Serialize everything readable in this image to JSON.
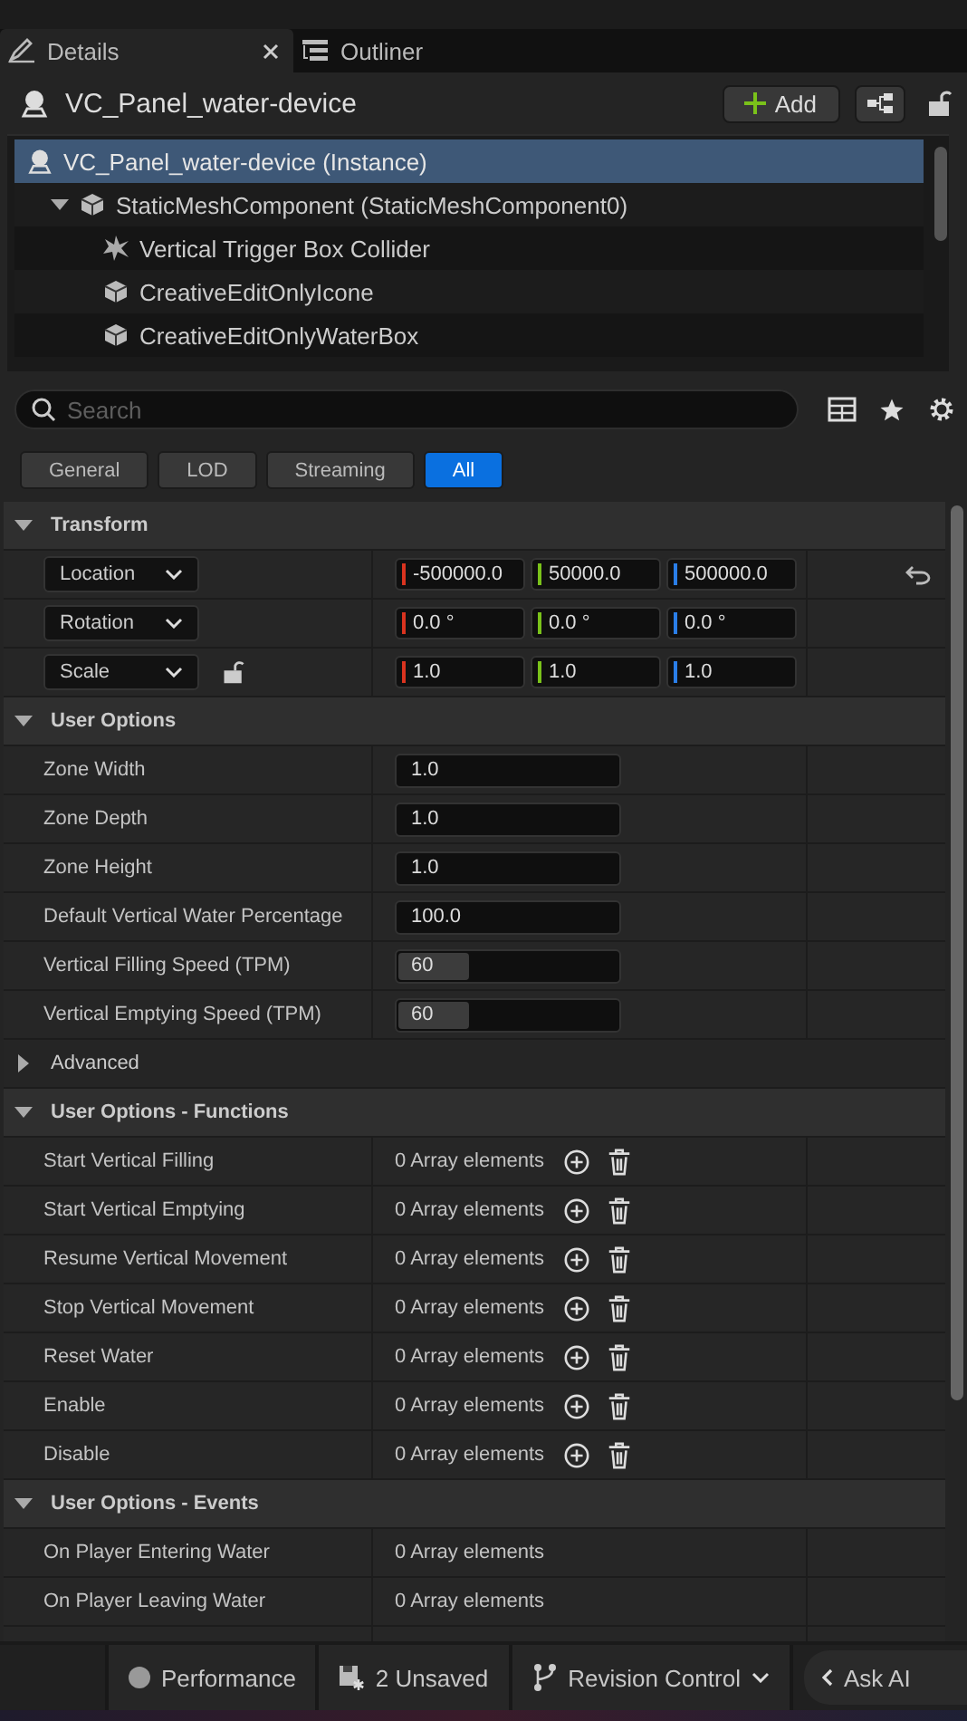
{
  "tabs": [
    {
      "label": "Details",
      "selected": true
    },
    {
      "label": "Outliner",
      "selected": false
    }
  ],
  "actor": {
    "title": "VC_Panel_water-device",
    "add_button": "Add"
  },
  "tree": [
    {
      "label": "VC_Panel_water-device (Instance)",
      "kind": "actor",
      "selected": true,
      "children": [
        {
          "label": "StaticMeshComponent (StaticMeshComponent0)",
          "kind": "mesh",
          "selected": false,
          "expanded": true,
          "children": [
            {
              "label": "Vertical Trigger Box Collider",
              "kind": "collider",
              "selected": false
            },
            {
              "label": "CreativeEditOnlyIcone",
              "kind": "mesh",
              "selected": false
            },
            {
              "label": "CreativeEditOnlyWaterBox",
              "kind": "mesh",
              "selected": false
            }
          ]
        }
      ]
    }
  ],
  "search": {
    "placeholder": "Search"
  },
  "filters": [
    {
      "label": "General",
      "selected": false
    },
    {
      "label": "LOD",
      "selected": false
    },
    {
      "label": "Streaming",
      "selected": false
    },
    {
      "label": "All",
      "selected": true
    }
  ],
  "sections": [
    {
      "title": "Transform",
      "expanded": true,
      "rows": [
        {
          "kind": "vector",
          "label": "Location",
          "values": [
            "-500000.0",
            "50000.0",
            "500000.0"
          ],
          "resettable": true
        },
        {
          "kind": "vector",
          "label": "Rotation",
          "values": [
            "0.0 °",
            "0.0 °",
            "0.0 °"
          ],
          "resettable": false
        },
        {
          "kind": "vector",
          "label": "Scale",
          "values": [
            "1.0",
            "1.0",
            "1.0"
          ],
          "resettable": false,
          "locked": false
        }
      ]
    },
    {
      "title": "User Options",
      "expanded": true,
      "rows": [
        {
          "kind": "number",
          "label": "Zone Width",
          "value": "1.0"
        },
        {
          "kind": "number",
          "label": "Zone Depth",
          "value": "1.0"
        },
        {
          "kind": "number",
          "label": "Zone Height",
          "value": "1.0"
        },
        {
          "kind": "number",
          "label": "Default Vertical Water Percentage",
          "value": "100.0"
        },
        {
          "kind": "slider",
          "label": "Vertical Filling Speed (TPM)",
          "value": "60",
          "level": 0.32
        },
        {
          "kind": "slider",
          "label": "Vertical Emptying Speed (TPM)",
          "value": "60",
          "level": 0.32
        }
      ]
    },
    {
      "title": "Advanced",
      "expanded": false
    },
    {
      "title": "User Options - Functions",
      "expanded": true,
      "rows": [
        {
          "kind": "array",
          "label": "Start Vertical Filling",
          "value": "0 Array elements"
        },
        {
          "kind": "array",
          "label": "Start Vertical Emptying",
          "value": "0 Array elements"
        },
        {
          "kind": "array",
          "label": "Resume Vertical Movement",
          "value": "0 Array elements"
        },
        {
          "kind": "array",
          "label": "Stop Vertical Movement",
          "value": "0 Array elements"
        },
        {
          "kind": "array",
          "label": "Reset Water",
          "value": "0 Array elements"
        },
        {
          "kind": "array",
          "label": "Enable",
          "value": "0 Array elements"
        },
        {
          "kind": "array",
          "label": "Disable",
          "value": "0 Array elements"
        }
      ]
    },
    {
      "title": "User Options - Events",
      "expanded": true,
      "rows": [
        {
          "kind": "event",
          "label": "On Player Entering Water",
          "value": "0 Array elements"
        },
        {
          "kind": "event",
          "label": "On Player Leaving Water",
          "value": "0 Array elements"
        }
      ]
    }
  ],
  "status_bar": [
    {
      "kind": "performance",
      "label": "Performance"
    },
    {
      "kind": "unsaved",
      "label": "2 Unsaved"
    },
    {
      "kind": "revision",
      "label": "Revision Control"
    },
    {
      "kind": "ai",
      "label": "Ask AI"
    }
  ]
}
